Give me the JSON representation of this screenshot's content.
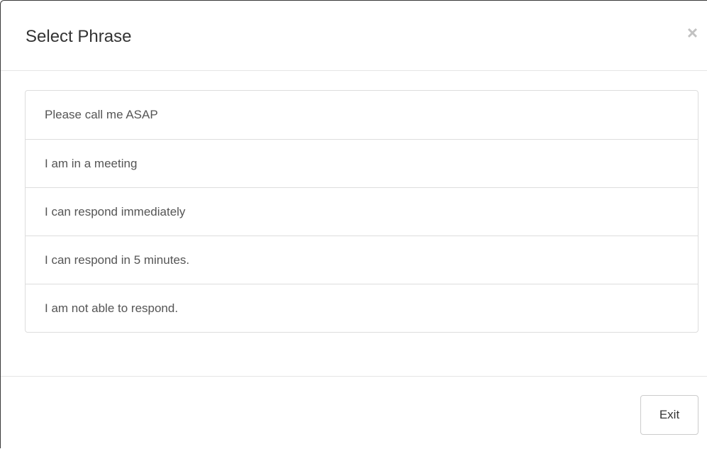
{
  "modal": {
    "title": "Select Phrase",
    "close_glyph": "×",
    "phrases": [
      {
        "label": "Please call me ASAP"
      },
      {
        "label": "I am in a meeting"
      },
      {
        "label": "I can respond immediately"
      },
      {
        "label": "I can respond in 5 minutes."
      },
      {
        "label": "I am not able to respond."
      }
    ],
    "footer": {
      "exit_label": "Exit"
    }
  },
  "colors": {
    "title": "#333333",
    "item_text": "#555555",
    "border": "#dddddd",
    "divider": "#e5e5e5",
    "close_icon": "#c2c2c2"
  }
}
